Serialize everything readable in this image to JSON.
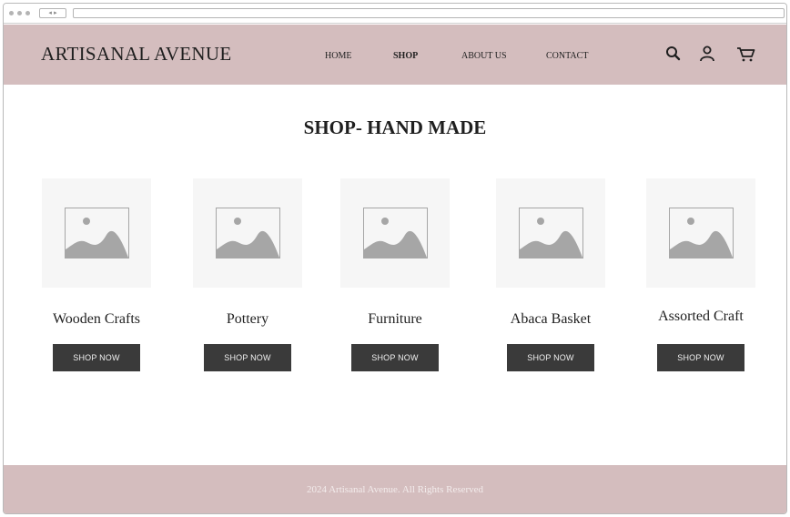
{
  "browser": {
    "nav_glyph": "◂ ▸"
  },
  "header": {
    "brand": "ARTISANAL AVENUE",
    "nav": [
      {
        "label": "HOME",
        "active": false
      },
      {
        "label": "SHOP",
        "active": true
      },
      {
        "label": "ABOUT US",
        "active": false
      },
      {
        "label": "CONTACT",
        "active": false
      }
    ],
    "icons": [
      "search-icon",
      "user-icon",
      "cart-icon"
    ]
  },
  "main": {
    "title": "SHOP- HAND MADE",
    "products": [
      {
        "name": "Wooden Crafts",
        "button": "SHOP NOW"
      },
      {
        "name": "Pottery",
        "button": "SHOP NOW"
      },
      {
        "name": "Furniture",
        "button": "SHOP NOW"
      },
      {
        "name": "Abaca Basket",
        "button": "SHOP NOW"
      },
      {
        "name": "Assorted Craft",
        "button": "SHOP NOW"
      }
    ]
  },
  "footer": {
    "text": "2024 Artisanal Avenue. All Rights Reserved"
  },
  "colors": {
    "header_bg": "#d4bdbe",
    "button_bg": "#3a3a3a",
    "thumb_bg": "#f6f6f6"
  }
}
